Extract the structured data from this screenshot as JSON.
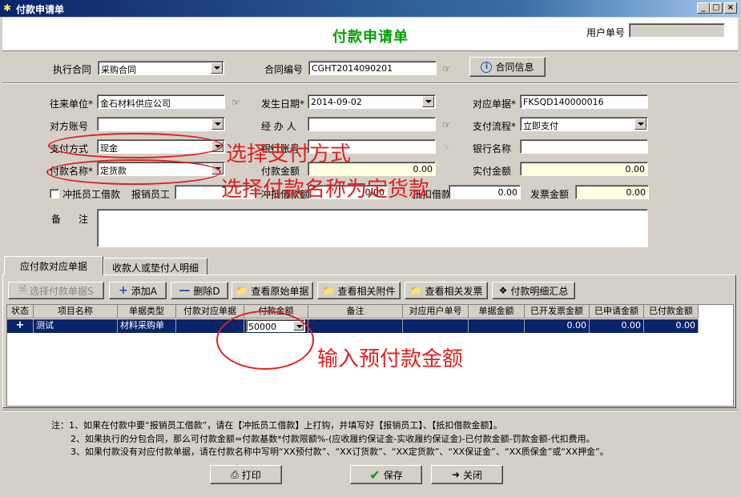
{
  "window": {
    "title": "付款申请单",
    "btn_min": "_",
    "btn_max": "□",
    "btn_close": "×"
  },
  "header": {
    "main_title": "付款申请单",
    "user_no_label": "用户单号",
    "user_no_value": ""
  },
  "contract": {
    "exec_label": "执行合同",
    "exec_value": "采购合同",
    "no_label": "合同编号",
    "no_value": "CGHT2014090201",
    "info_button": "合同信息"
  },
  "form": {
    "partner_label": "往来单位*",
    "partner_value": "金石材料供应公司",
    "date_label": "发生日期*",
    "date_value": "2014-09-02",
    "ref_no_label": "对应单据*",
    "ref_no_value": "FKSQD140000016",
    "account_label": "对方账号",
    "account_value": "",
    "handler_label": "经 办 人",
    "handler_value": "",
    "flow_label": "支付流程*",
    "flow_value": "立即支付",
    "method_label": "支付方式",
    "method_value": "现金",
    "bank_acct_label": "银行账号",
    "bank_acct_value": "",
    "bank_name_label": "银行名称",
    "bank_name_value": "",
    "pay_name_label": "付款名称*",
    "pay_name_value": "定货款",
    "pay_amount_label": "付款金额",
    "pay_amount_value": "0.00",
    "actual_amount_label": "实付金额",
    "actual_amount_value": "0.00",
    "offset_loan_label": "冲抵员工借款",
    "reimburse_staff_label": "报销员工",
    "reimburse_staff_value": "",
    "offset_amount_label": "冲抵借款额",
    "offset_amount_value": "0.00",
    "deduct_label": "抵扣借款",
    "deduct_value": "0.00",
    "invoice_label": "发票金额",
    "invoice_value": "0.00",
    "remark_label_1": "备",
    "remark_label_2": "注"
  },
  "tabs": [
    {
      "label": "应付款对应单据"
    },
    {
      "label": "收款人或垫付人明细"
    }
  ],
  "toolbar": {
    "select_doc": "选择付款单据S",
    "add": "添加A",
    "delete": "删除D",
    "view_original": "查看原始单据",
    "view_attach": "查看相关附件",
    "view_invoice": "查看相关发票",
    "pay_summary": "付款明细汇总"
  },
  "grid": {
    "columns": [
      "状态",
      "项目名称",
      "单据类型",
      "付款对应单据",
      "付款金额",
      "备注",
      "对应用户单号",
      "单据金额",
      "已开发票金额",
      "已申请金额",
      "已付款金额"
    ],
    "row": {
      "status": "+",
      "project": "测试",
      "doc_type": "材料采购单",
      "pay_doc": "",
      "pay_amount": "50000",
      "remark": "",
      "user_no": "",
      "doc_amount": "",
      "invoiced": "0.00",
      "applied": "0.00",
      "paid": "0.00"
    }
  },
  "notes": {
    "line1": "注：1、如果在付款中要“报销员工借款”，请在【冲抵员工借款】上打钩，并填写好【报销员工】、【抵扣借款金额】。",
    "line2": "2、如果执行的分包合同，那么可付款金额=付款基数*付款限额%-(应收履约保证金-实收履约保证金)-已付款金额-罚款金额-代扣费用。",
    "line3": "3、如果付款没有对应付款单据，请在付款名称中写明“XX预付款”、“XX订货款”、“XX定货款”、“XX保证金”、“XX质保金”或“XX押金”。"
  },
  "footer": {
    "print": "打印",
    "save": "保存",
    "close": "关闭"
  },
  "annotations": {
    "method": "选择支付方式",
    "pay_name": "选择付款名称为定货款",
    "amount": "输入预付款金额"
  }
}
